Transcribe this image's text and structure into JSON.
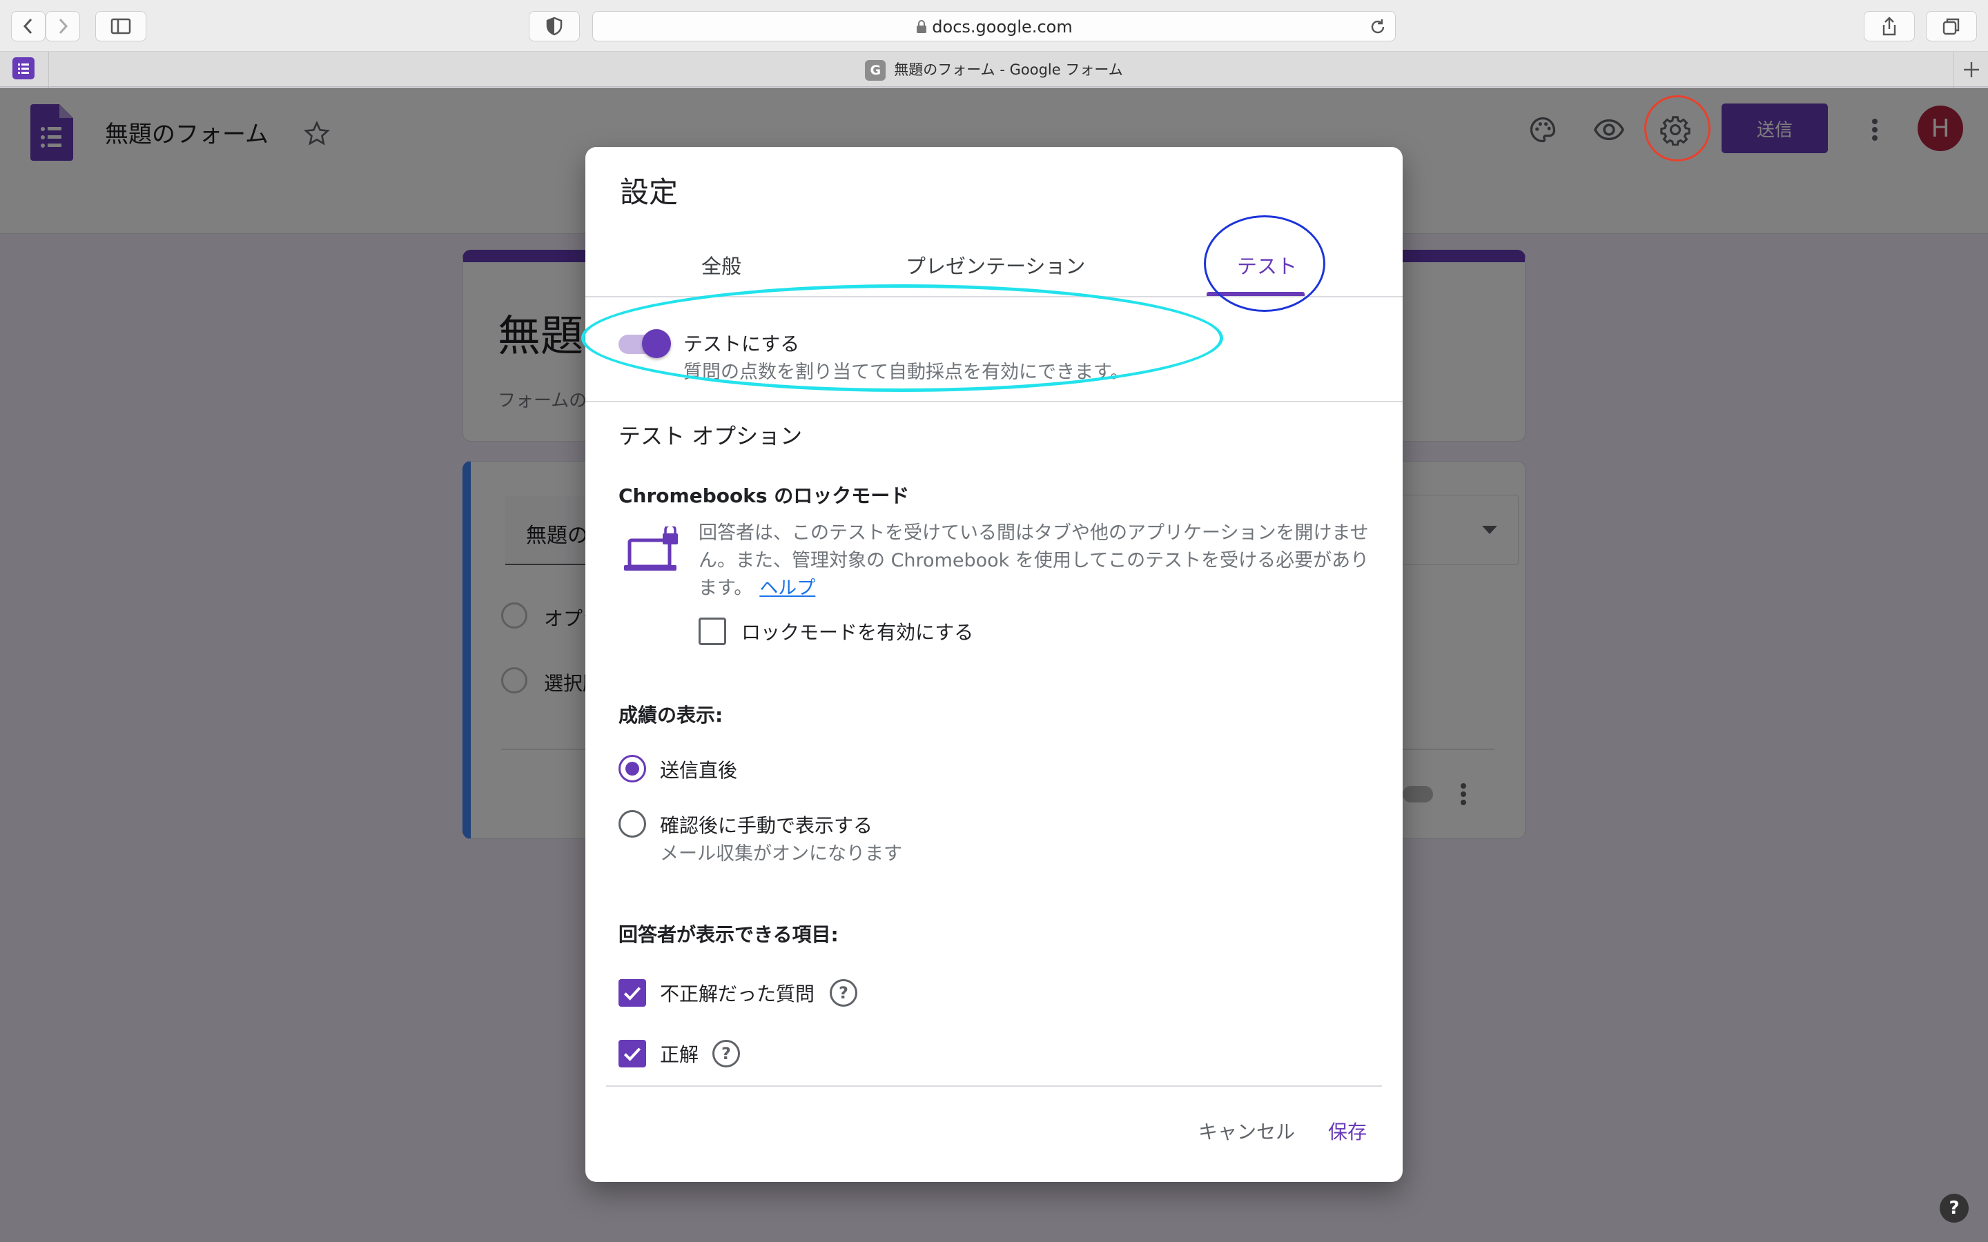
{
  "browser": {
    "url": "docs.google.com",
    "tab_title": "無題のフォーム - Google フォーム",
    "tab_favicon": "G"
  },
  "app": {
    "form_title": "無題のフォーム",
    "send_label": "送信",
    "avatar_initial": "H",
    "icons": [
      "forms-logo-icon",
      "star-icon",
      "palette-icon",
      "eye-icon",
      "gear-icon",
      "more-vert-icon"
    ]
  },
  "form_bg": {
    "title": "無題",
    "description": "フォームの",
    "question": "無題の",
    "options": [
      "オプシ",
      "選択肢"
    ]
  },
  "dialog": {
    "title": "設定",
    "tabs": [
      {
        "label": "全般",
        "active": false
      },
      {
        "label": "プレゼンテーション",
        "active": false
      },
      {
        "label": "テスト",
        "active": true
      }
    ],
    "quiz_toggle": {
      "label": "テストにする",
      "description": "質問の点数を割り当てて自動採点を有効にできます。",
      "on": true
    },
    "options_heading": "テスト オプション",
    "lock_mode": {
      "heading": "Chromebooks のロックモード",
      "description": "回答者は、このテストを受けている間はタブや他のアプリケーションを開けません。また、管理対象の Chromebook を使用してこのテストを受ける必要があります。",
      "help_link": "ヘルプ",
      "checkbox_label": "ロックモードを有効にする",
      "checked": false
    },
    "release_grade": {
      "heading": "成績の表示:",
      "options": [
        {
          "label": "送信直後",
          "sub": "",
          "selected": true
        },
        {
          "label": "確認後に手動で表示する",
          "sub": "メール収集がオンになります",
          "selected": false
        }
      ]
    },
    "respondent_view": {
      "heading": "回答者が表示できる項目:",
      "items": [
        {
          "label": "不正解だった質問",
          "checked": true
        },
        {
          "label": "正解",
          "checked": true
        }
      ]
    },
    "cancel_label": "キャンセル",
    "save_label": "保存"
  },
  "colors": {
    "accent": "#673ab7",
    "link": "#1a73e8",
    "annotation_red": "#e8412d",
    "annotation_blue": "#1c34d9",
    "annotation_cyan": "#22e2ec"
  },
  "help_fab": "?"
}
